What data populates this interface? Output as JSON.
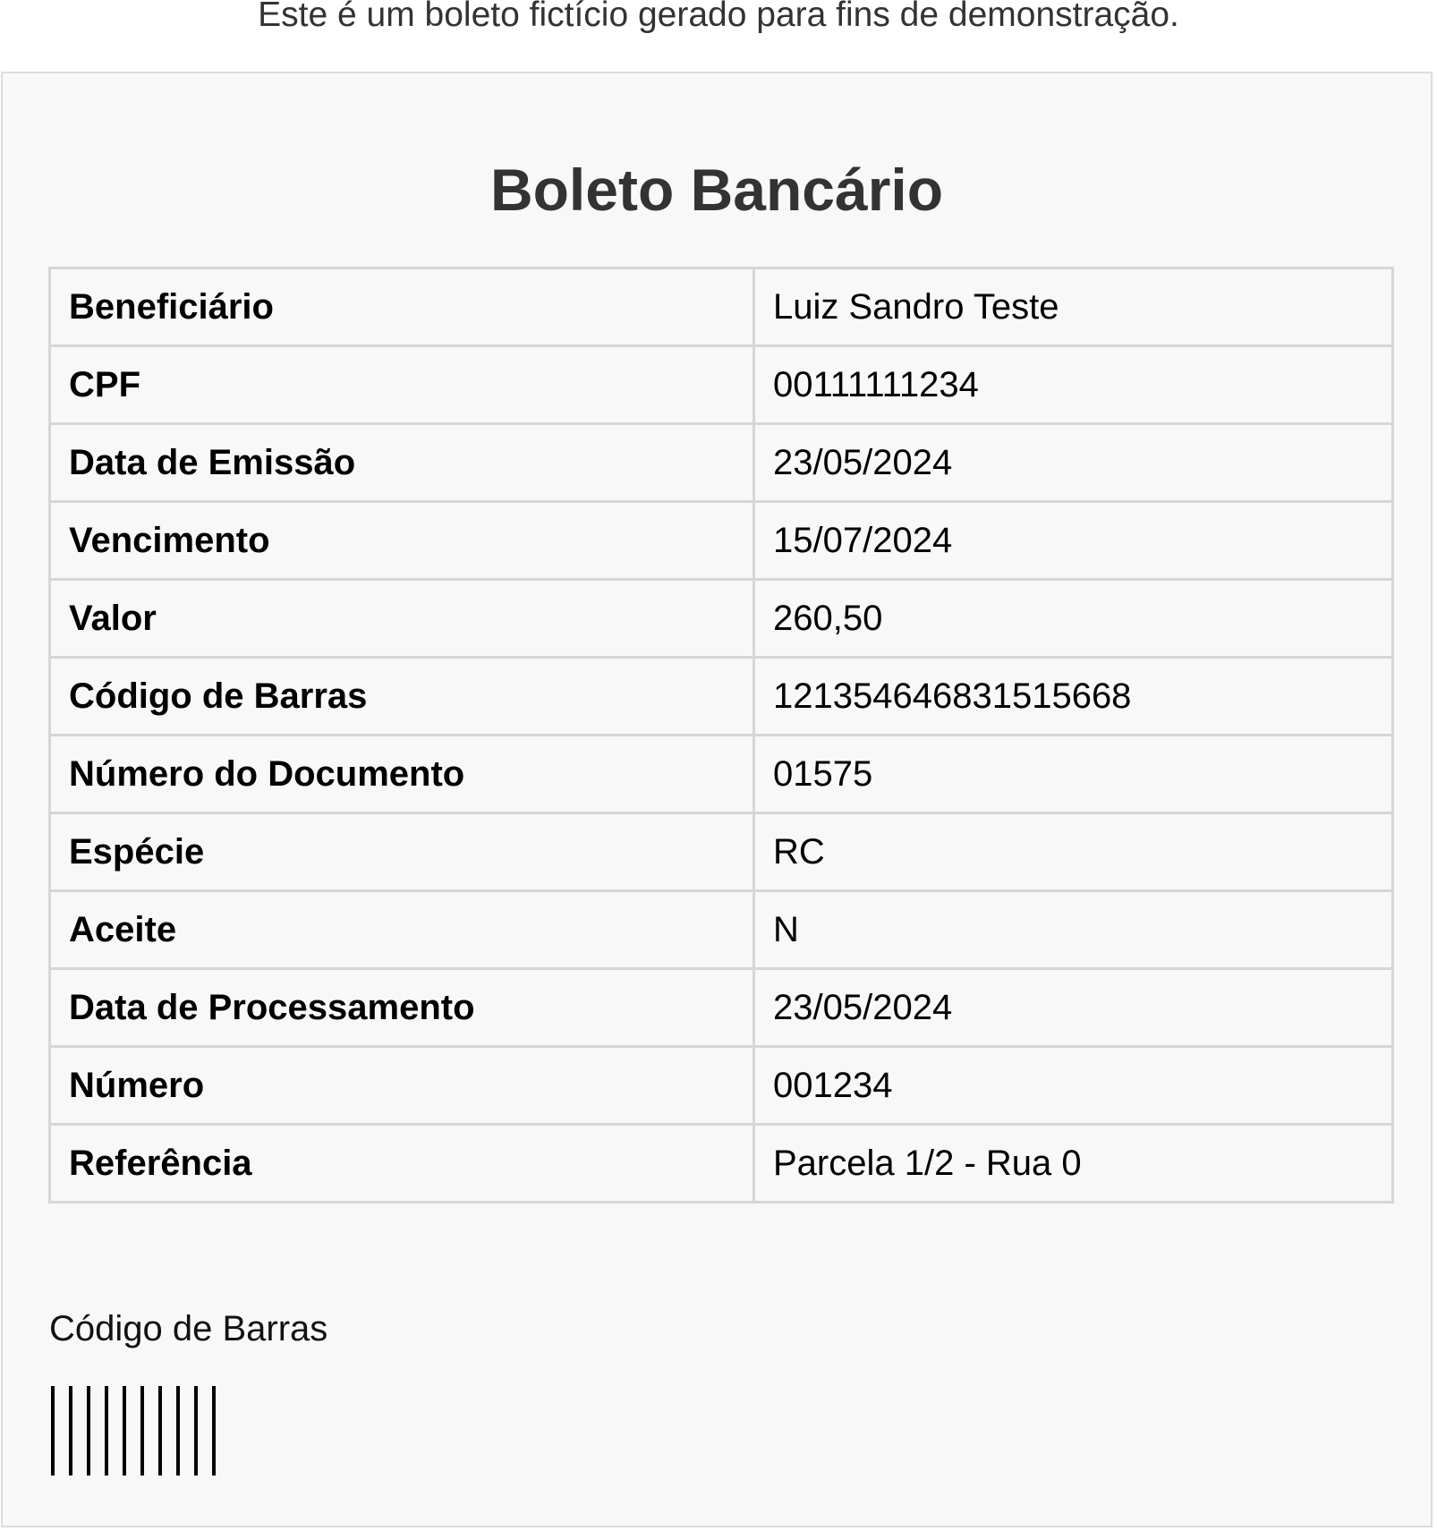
{
  "notice": "Este é um boleto fictício gerado para fins de demonstração.",
  "boleto": {
    "title": "Boleto Bancário",
    "rows": [
      {
        "label": "Beneficiário",
        "value": "Luiz Sandro Teste"
      },
      {
        "label": "CPF",
        "value": "00111111234"
      },
      {
        "label": "Data de Emissão",
        "value": "23/05/2024"
      },
      {
        "label": "Vencimento",
        "value": "15/07/2024"
      },
      {
        "label": "Valor",
        "value": "260,50"
      },
      {
        "label": "Código de Barras",
        "value": "121354646831515668"
      },
      {
        "label": "Número do Documento",
        "value": "01575"
      },
      {
        "label": "Espécie",
        "value": "RC"
      },
      {
        "label": "Aceite",
        "value": "N"
      },
      {
        "label": "Data de Processamento",
        "value": "23/05/2024"
      },
      {
        "label": "Número",
        "value": "001234"
      },
      {
        "label": "Referência",
        "value": "Parcela 1/2 - Rua 0"
      }
    ],
    "barcode_label": "Código de Barras",
    "barcode_color": "#000000"
  }
}
